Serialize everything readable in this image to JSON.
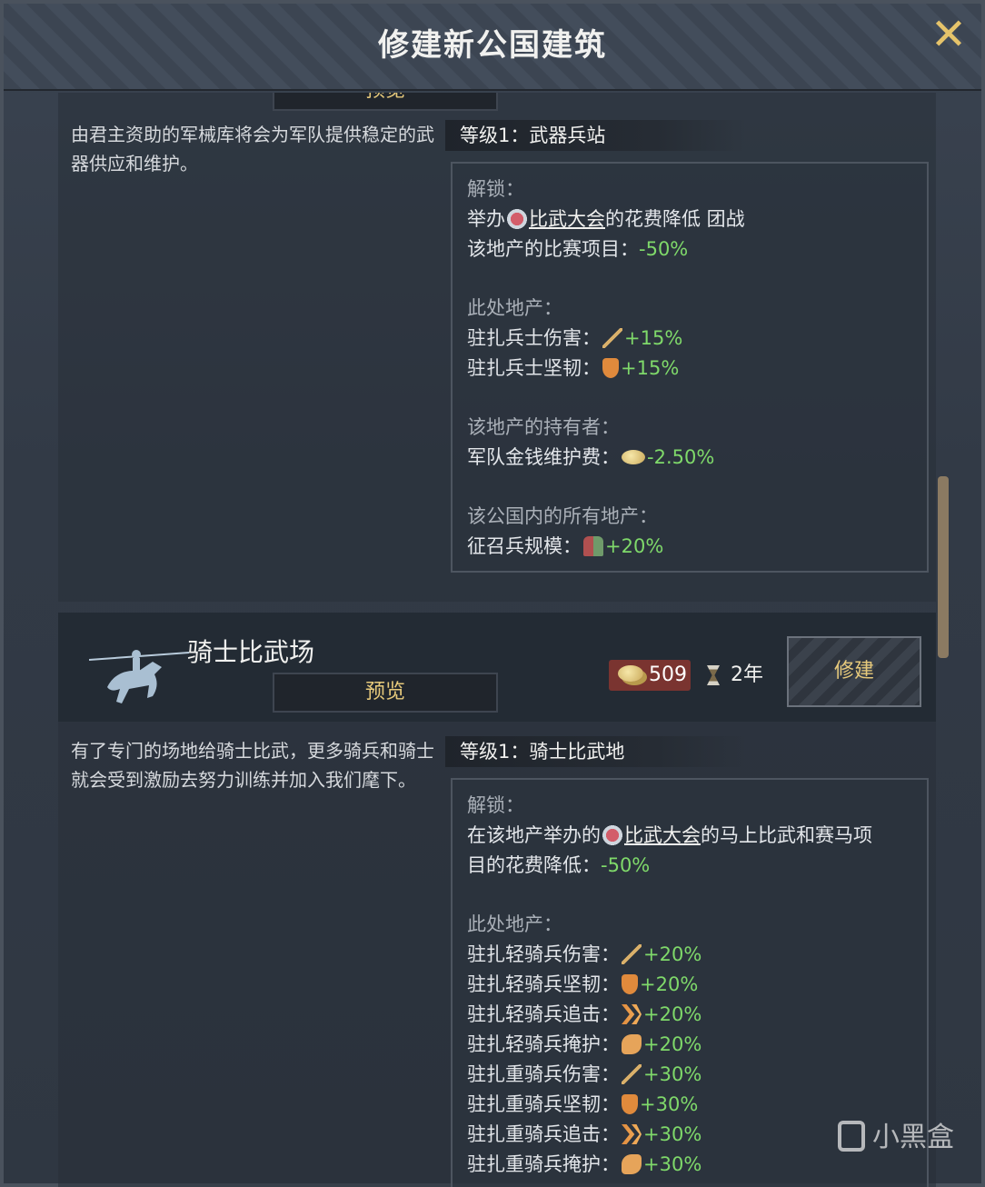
{
  "window": {
    "title": "修建新公国建筑"
  },
  "card1": {
    "preview_label": "预览",
    "description": "由君主资助的军械库将会为军队提供稳定的武器供应和维护。",
    "level_label": "等级1：武器兵站",
    "unlock_head": "解锁：",
    "unlock_line1_pre": "举办",
    "unlock_line1_link": "比武大会",
    "unlock_line1_post": "的花费降低 团战",
    "unlock_line2_label": "该地产的比赛项目：",
    "unlock_line2_value": "-50%",
    "local_head": "此处地产：",
    "local_effects": [
      {
        "label": "驻扎兵士伤害：",
        "icon": "sword-icon",
        "value": "+15%"
      },
      {
        "label": "驻扎兵士坚韧：",
        "icon": "shield-icon",
        "value": "+15%"
      }
    ],
    "holder_head": "该地产的持有者：",
    "holder_effect": {
      "label": "军队金钱维护费：",
      "icon": "gold-icon",
      "value": "-2.50%"
    },
    "duchy_head": "该公国内的所有地产：",
    "duchy_effect": {
      "label": "征召兵规模：",
      "icon": "levy-icon",
      "value": "+20%"
    }
  },
  "card2": {
    "name": "骑士比武场",
    "preview_label": "预览",
    "cost": "509",
    "duration": "2年",
    "build_label": "修建",
    "description": "有了专门的场地给骑士比武，更多骑兵和骑士就会受到激励去努力训练并加入我们麾下。",
    "level_label": "等级1：骑士比武地",
    "unlock_head": "解锁：",
    "unlock_line1_pre": "在该地产举办的",
    "unlock_line1_link": "比武大会",
    "unlock_line1_post": "的马上比武和赛马项",
    "unlock_line2_label": "目的花费降低：",
    "unlock_line2_value": "-50%",
    "local_head": "此处地产：",
    "local_effects": [
      {
        "label": "驻扎轻骑兵伤害：",
        "icon": "sword-icon",
        "value": "+20%"
      },
      {
        "label": "驻扎轻骑兵坚韧：",
        "icon": "shield-icon",
        "value": "+20%"
      },
      {
        "label": "驻扎轻骑兵追击：",
        "icon": "pursuit-icon",
        "value": "+20%"
      },
      {
        "label": "驻扎轻骑兵掩护：",
        "icon": "screen-icon",
        "value": "+20%"
      },
      {
        "label": "驻扎重骑兵伤害：",
        "icon": "sword-icon",
        "value": "+30%"
      },
      {
        "label": "驻扎重骑兵坚韧：",
        "icon": "shield-icon",
        "value": "+30%"
      },
      {
        "label": "驻扎重骑兵追击：",
        "icon": "pursuit-icon",
        "value": "+30%"
      },
      {
        "label": "驻扎重骑兵掩护：",
        "icon": "screen-icon",
        "value": "+30%"
      }
    ]
  },
  "watermark": "小黑盒"
}
